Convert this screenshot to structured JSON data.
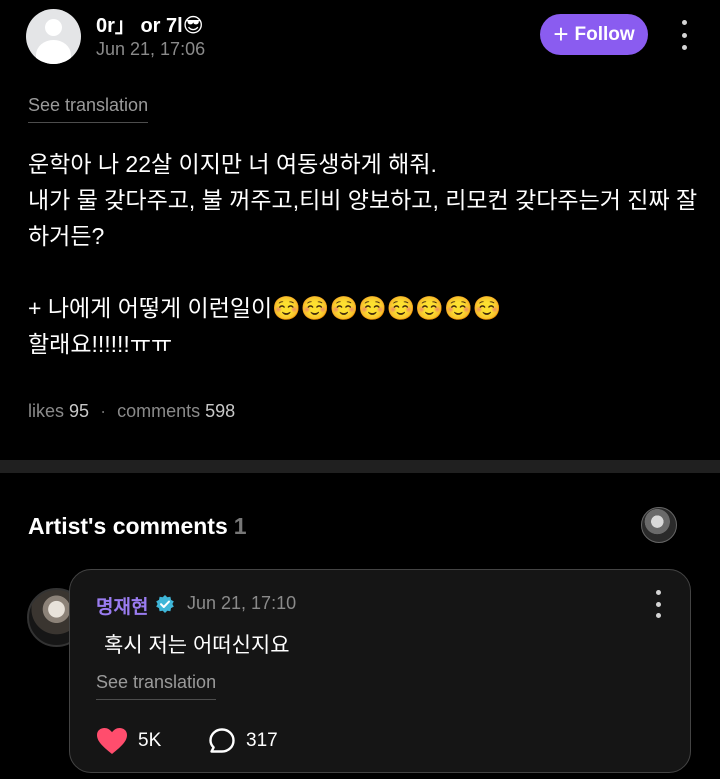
{
  "post": {
    "author_name": "0r」 or 7l😎",
    "date": "Jun 21, 17:06",
    "follow_label": "Follow",
    "see_translation": "See translation",
    "body": "운학아 나 22살 이지만 너 여동생하게 해줘.\n내가 물 갖다주고, 불 꺼주고,티비 양보하고, 리모컨 갖다주는거 진짜 잘하거든?\n\n+ 나에게 어떻게 이런일이☺️☺️☺️☺️☺️☺️☺️☺️\n할래요!!!!!!ㅠㅠ",
    "likes_label": "likes",
    "likes_count": "95",
    "separator": "·",
    "comments_label": "comments",
    "comments_count": "598"
  },
  "artist_comments": {
    "title": "Artist's comments",
    "count": "1"
  },
  "comment": {
    "author": "명재현",
    "date": "Jun 21, 17:10",
    "text": "혹시 저는 어떠신지요",
    "see_translation": "See translation",
    "like_count": "5K",
    "reply_count": "317"
  },
  "colors": {
    "accent": "#8a5cf0",
    "verified": "#3fb6d8",
    "like": "#ff4d6d"
  }
}
